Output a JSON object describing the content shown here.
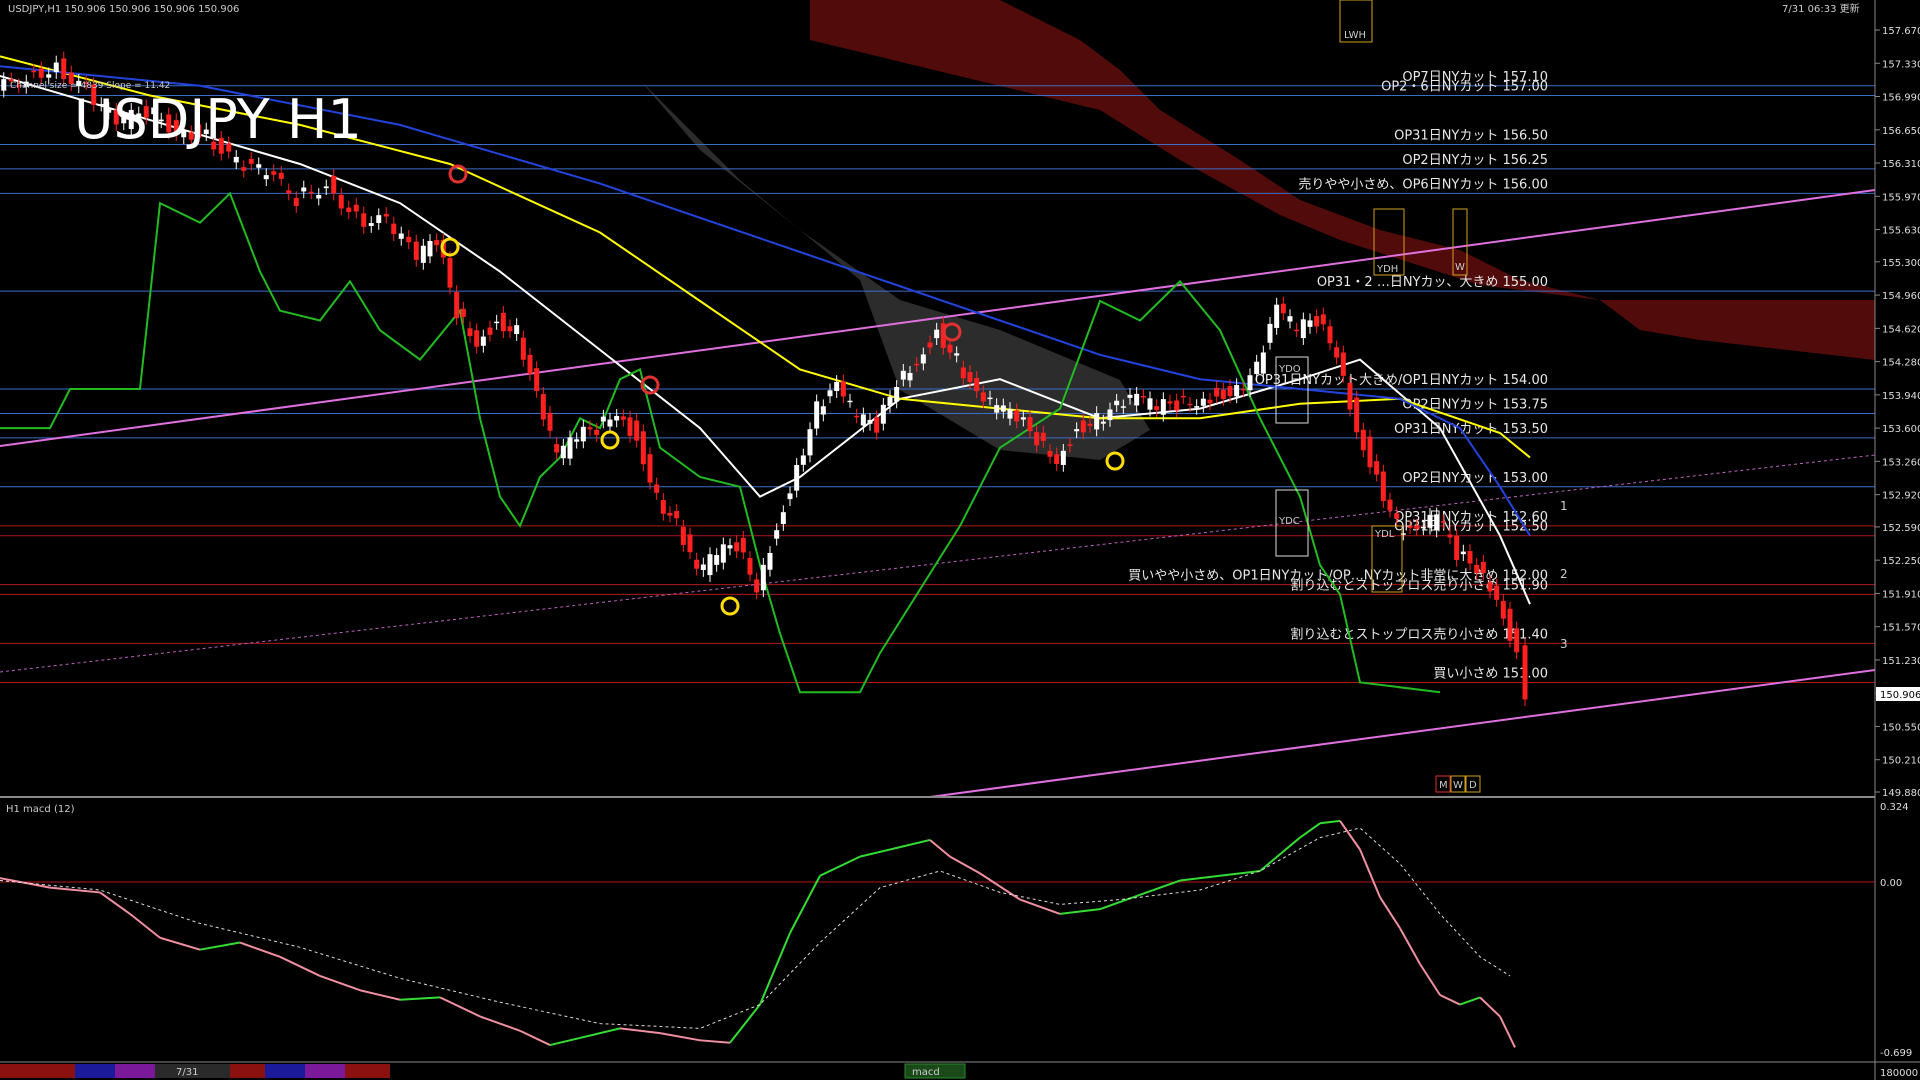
{
  "header": {
    "symbol_info": "USDJPY,H1  150.906 150.906 150.906 150.906",
    "timestamp": "7/31 06:33 更新",
    "channel_info": "Channel size = 4839 Slope = 11.42",
    "big_title": "USDJPY H1"
  },
  "macd_panel": {
    "title": "H1  macd (12)",
    "ticks": [
      "0.324",
      "0.00",
      "-0.699"
    ]
  },
  "bottom_bar": {
    "date_label": "7/31",
    "tab_label": "macd",
    "right_value": "180000"
  },
  "badges": {
    "ydh": "YDH",
    "ydo": "YDO",
    "ydc": "YDC",
    "ydl": "YDL",
    "lwh": "LWH",
    "m": "M",
    "w": "W",
    "d": "D",
    "price_now": "150.906",
    "target_1": "1",
    "target_2": "2",
    "target_3": "3"
  },
  "levels": [
    {
      "text": "OP7日NYカット 157.10",
      "price": 157.1,
      "color": "#3c6dc8"
    },
    {
      "text": "OP2・6日NYカット 157.00",
      "price": 157.0,
      "color": "#3c6dc8"
    },
    {
      "text": "OP31日NYカット 156.50",
      "price": 156.5,
      "color": "#3c6dc8"
    },
    {
      "text": "OP2日NYカット 156.25",
      "price": 156.25,
      "color": "#3c6dc8"
    },
    {
      "text": "売りやや小さめ、OP6日NYカット 156.00",
      "price": 156.0,
      "color": "#3c6dc8"
    },
    {
      "text": "OP31・2 …日NYカッ、大きめ 155.00",
      "price": 155.0,
      "color": "#3c6dc8"
    },
    {
      "text": "OP31日NYカット大きめ/OP1日NYカット 154.00",
      "price": 154.0,
      "color": "#3c6dc8"
    },
    {
      "text": "OP2日NYカット 153.75",
      "price": 153.75,
      "color": "#3c6dc8"
    },
    {
      "text": "OP31日NYカット 153.50",
      "price": 153.5,
      "color": "#3c6dc8"
    },
    {
      "text": "OP2日NYカット 153.00",
      "price": 153.0,
      "color": "#3c6dc8"
    },
    {
      "text": "OP31日NYカット 152.60",
      "price": 152.6,
      "color": "#b01818"
    },
    {
      "text": "OP31日NYカット 152.50",
      "price": 152.5,
      "color": "#b01818"
    },
    {
      "text": "買いやや小さめ、OP1日NYカット/OP…NYカット非常に大きめ 152.00",
      "price": 152.0,
      "color": "#b01818"
    },
    {
      "text": "割り込むとストップロス売り小さめ 151.90",
      "price": 151.9,
      "color": "#b01818"
    },
    {
      "text": "割り込むとストップロス売り小さめ 151.40",
      "price": 151.4,
      "color": "#b01818"
    },
    {
      "text": "買い小さめ 151.00",
      "price": 151.0,
      "color": "#b01818"
    }
  ],
  "chart_data": {
    "type": "candlestick",
    "title": "USDJPY H1",
    "ylim": [
      149.88,
      157.67
    ],
    "price_ticks": [
      157.67,
      157.33,
      156.99,
      156.65,
      156.31,
      155.97,
      155.63,
      155.3,
      154.96,
      154.62,
      154.28,
      153.94,
      153.6,
      153.26,
      152.92,
      152.59,
      152.25,
      151.91,
      151.57,
      151.23,
      150.89,
      150.55,
      150.21,
      149.88
    ],
    "last_price": 150.906,
    "close_path": [
      [
        0,
        157.05
      ],
      [
        30,
        157.2
      ],
      [
        60,
        157.3
      ],
      [
        90,
        157.05
      ],
      [
        120,
        156.7
      ],
      [
        150,
        156.85
      ],
      [
        180,
        156.65
      ],
      [
        210,
        156.6
      ],
      [
        240,
        156.3
      ],
      [
        270,
        156.2
      ],
      [
        300,
        155.95
      ],
      [
        330,
        156.1
      ],
      [
        360,
        155.75
      ],
      [
        390,
        155.7
      ],
      [
        420,
        155.35
      ],
      [
        440,
        155.5
      ],
      [
        460,
        154.8
      ],
      [
        480,
        154.5
      ],
      [
        500,
        154.7
      ],
      [
        520,
        154.6
      ],
      [
        540,
        153.9
      ],
      [
        560,
        153.3
      ],
      [
        580,
        153.5
      ],
      [
        600,
        153.6
      ],
      [
        620,
        153.8
      ],
      [
        640,
        153.5
      ],
      [
        660,
        152.9
      ],
      [
        680,
        152.6
      ],
      [
        700,
        152.1
      ],
      [
        720,
        152.3
      ],
      [
        740,
        152.4
      ],
      [
        760,
        152.0
      ],
      [
        780,
        152.6
      ],
      [
        800,
        153.2
      ],
      [
        820,
        153.8
      ],
      [
        840,
        154.0
      ],
      [
        860,
        153.7
      ],
      [
        880,
        153.6
      ],
      [
        900,
        154.1
      ],
      [
        920,
        154.3
      ],
      [
        940,
        154.6
      ],
      [
        960,
        154.3
      ],
      [
        980,
        153.9
      ],
      [
        1000,
        153.8
      ],
      [
        1020,
        153.7
      ],
      [
        1040,
        153.5
      ],
      [
        1060,
        153.3
      ],
      [
        1080,
        153.6
      ],
      [
        1100,
        153.7
      ],
      [
        1120,
        153.8
      ],
      [
        1140,
        153.9
      ],
      [
        1160,
        153.8
      ],
      [
        1180,
        153.85
      ],
      [
        1200,
        153.9
      ],
      [
        1220,
        153.95
      ],
      [
        1240,
        154.0
      ],
      [
        1260,
        154.2
      ],
      [
        1280,
        154.8
      ],
      [
        1300,
        154.6
      ],
      [
        1320,
        154.7
      ],
      [
        1340,
        154.4
      ],
      [
        1360,
        153.6
      ],
      [
        1380,
        153.1
      ],
      [
        1400,
        152.6
      ],
      [
        1420,
        152.5
      ],
      [
        1440,
        152.7
      ],
      [
        1460,
        152.3
      ],
      [
        1480,
        152.2
      ],
      [
        1500,
        151.9
      ],
      [
        1520,
        151.3
      ],
      [
        1530,
        150.906
      ]
    ],
    "series": [
      {
        "color": "#ffffff",
        "values": [
          [
            0,
            157.2
          ],
          [
            100,
            156.9
          ],
          [
            200,
            156.6
          ],
          [
            300,
            156.3
          ],
          [
            400,
            155.9
          ],
          [
            500,
            155.2
          ],
          [
            600,
            154.4
          ],
          [
            700,
            153.6
          ],
          [
            760,
            152.9
          ],
          [
            800,
            153.1
          ],
          [
            900,
            153.9
          ],
          [
            1000,
            154.1
          ],
          [
            1100,
            153.7
          ],
          [
            1200,
            153.8
          ],
          [
            1300,
            154.1
          ],
          [
            1360,
            154.3
          ],
          [
            1440,
            153.6
          ],
          [
            1500,
            152.5
          ],
          [
            1530,
            151.8
          ]
        ]
      },
      {
        "color": "#ffff00",
        "values": [
          [
            0,
            157.4
          ],
          [
            150,
            157.0
          ],
          [
            300,
            156.7
          ],
          [
            450,
            156.3
          ],
          [
            600,
            155.6
          ],
          [
            700,
            154.9
          ],
          [
            800,
            154.2
          ],
          [
            900,
            153.9
          ],
          [
            1000,
            153.8
          ],
          [
            1100,
            153.7
          ],
          [
            1200,
            153.7
          ],
          [
            1300,
            153.85
          ],
          [
            1400,
            153.9
          ],
          [
            1500,
            153.55
          ],
          [
            1530,
            153.3
          ]
        ]
      },
      {
        "color": "#2244dd",
        "values": [
          [
            0,
            157.3
          ],
          [
            200,
            157.1
          ],
          [
            400,
            156.7
          ],
          [
            600,
            156.1
          ],
          [
            800,
            155.4
          ],
          [
            1000,
            154.7
          ],
          [
            1100,
            154.35
          ],
          [
            1200,
            154.1
          ],
          [
            1300,
            154.0
          ],
          [
            1400,
            153.9
          ],
          [
            1460,
            153.6
          ],
          [
            1500,
            153.0
          ],
          [
            1530,
            152.5
          ]
        ]
      },
      {
        "color": "#22bb22",
        "values": [
          [
            0,
            153.6
          ],
          [
            50,
            153.6
          ],
          [
            70,
            154.0
          ],
          [
            140,
            154.0
          ],
          [
            160,
            155.9
          ],
          [
            200,
            155.7
          ],
          [
            230,
            156.0
          ],
          [
            260,
            155.2
          ],
          [
            280,
            154.8
          ],
          [
            320,
            154.7
          ],
          [
            350,
            155.1
          ],
          [
            380,
            154.6
          ],
          [
            420,
            154.3
          ],
          [
            460,
            154.8
          ],
          [
            480,
            153.7
          ],
          [
            500,
            152.9
          ],
          [
            520,
            152.6
          ],
          [
            540,
            153.1
          ],
          [
            560,
            153.3
          ],
          [
            580,
            153.7
          ],
          [
            600,
            153.6
          ],
          [
            620,
            154.1
          ],
          [
            640,
            154.2
          ],
          [
            660,
            153.4
          ],
          [
            700,
            153.1
          ],
          [
            740,
            153.0
          ],
          [
            760,
            152.2
          ],
          [
            780,
            151.5
          ],
          [
            800,
            150.9
          ],
          [
            860,
            150.9
          ],
          [
            880,
            151.3
          ],
          [
            960,
            152.6
          ],
          [
            1000,
            153.4
          ],
          [
            1060,
            153.8
          ],
          [
            1100,
            154.9
          ],
          [
            1140,
            154.7
          ],
          [
            1180,
            155.1
          ],
          [
            1220,
            154.6
          ],
          [
            1260,
            153.7
          ],
          [
            1300,
            152.9
          ],
          [
            1320,
            152.2
          ],
          [
            1340,
            151.9
          ],
          [
            1360,
            151.0
          ],
          [
            1440,
            150.9
          ]
        ]
      }
    ],
    "macd": {
      "ylim": [
        -0.699,
        0.324
      ],
      "values": [
        [
          0,
          0.03
        ],
        [
          50,
          -0.01
        ],
        [
          100,
          -0.03
        ],
        [
          130,
          -0.12
        ],
        [
          160,
          -0.22
        ],
        [
          200,
          -0.27
        ],
        [
          240,
          -0.24
        ],
        [
          280,
          -0.3
        ],
        [
          320,
          -0.38
        ],
        [
          360,
          -0.44
        ],
        [
          400,
          -0.48
        ],
        [
          440,
          -0.47
        ],
        [
          480,
          -0.55
        ],
        [
          520,
          -0.61
        ],
        [
          550,
          -0.67
        ],
        [
          580,
          -0.64
        ],
        [
          620,
          -0.6
        ],
        [
          660,
          -0.62
        ],
        [
          700,
          -0.65
        ],
        [
          730,
          -0.66
        ],
        [
          760,
          -0.5
        ],
        [
          790,
          -0.2
        ],
        [
          820,
          0.04
        ],
        [
          860,
          0.12
        ],
        [
          900,
          0.16
        ],
        [
          930,
          0.19
        ],
        [
          950,
          0.12
        ],
        [
          980,
          0.05
        ],
        [
          1020,
          -0.06
        ],
        [
          1060,
          -0.12
        ],
        [
          1100,
          -0.1
        ],
        [
          1140,
          -0.04
        ],
        [
          1180,
          0.02
        ],
        [
          1220,
          0.04
        ],
        [
          1260,
          0.06
        ],
        [
          1300,
          0.2
        ],
        [
          1320,
          0.26
        ],
        [
          1340,
          0.27
        ],
        [
          1360,
          0.15
        ],
        [
          1380,
          -0.05
        ],
        [
          1400,
          -0.18
        ],
        [
          1420,
          -0.33
        ],
        [
          1440,
          -0.46
        ],
        [
          1460,
          -0.5
        ],
        [
          1480,
          -0.47
        ],
        [
          1500,
          -0.55
        ],
        [
          1515,
          -0.68
        ]
      ],
      "signal": [
        [
          0,
          0.02
        ],
        [
          100,
          -0.02
        ],
        [
          200,
          -0.16
        ],
        [
          300,
          -0.26
        ],
        [
          400,
          -0.39
        ],
        [
          500,
          -0.49
        ],
        [
          600,
          -0.58
        ],
        [
          700,
          -0.6
        ],
        [
          760,
          -0.5
        ],
        [
          820,
          -0.24
        ],
        [
          880,
          -0.01
        ],
        [
          940,
          0.06
        ],
        [
          1000,
          -0.03
        ],
        [
          1060,
          -0.08
        ],
        [
          1120,
          -0.06
        ],
        [
          1200,
          -0.02
        ],
        [
          1260,
          0.06
        ],
        [
          1320,
          0.2
        ],
        [
          1360,
          0.24
        ],
        [
          1400,
          0.09
        ],
        [
          1440,
          -0.12
        ],
        [
          1480,
          -0.3
        ],
        [
          1510,
          -0.38
        ]
      ]
    }
  }
}
